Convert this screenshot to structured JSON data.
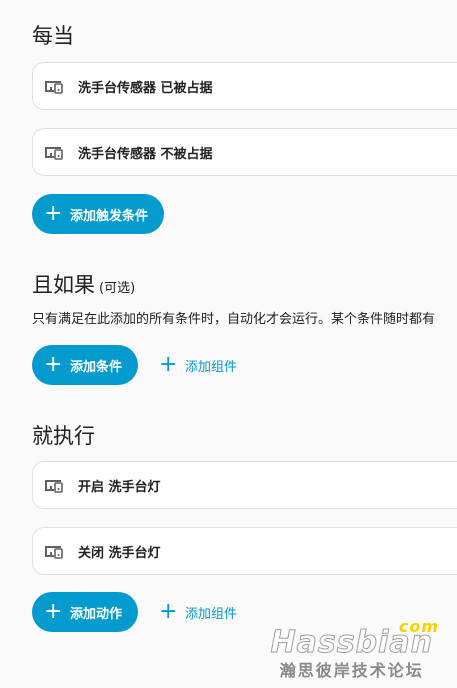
{
  "when": {
    "title": "每当",
    "triggers": [
      {
        "label": "洗手台传感器 已被占据",
        "icon": "device-icon"
      },
      {
        "label": "洗手台传感器 不被占据",
        "icon": "device-icon"
      }
    ],
    "add_trigger_label": "添加触发条件"
  },
  "and_if": {
    "title": "且如果",
    "optional": "(可选)",
    "description": "只有满足在此添加的所有条件时，自动化才会运行。某个条件随时都有",
    "add_condition_label": "添加条件",
    "add_block_label": "添加组件"
  },
  "then_do": {
    "title": "就执行",
    "actions": [
      {
        "label": "开启 洗手台灯",
        "icon": "device-icon"
      },
      {
        "label": "关闭 洗手台灯",
        "icon": "device-icon"
      }
    ],
    "add_action_label": "添加动作",
    "add_block_label": "添加组件"
  },
  "watermark": {
    "brand": "Hassbian",
    "com": "com",
    "sub": "瀚思彼岸技术论坛"
  },
  "colors": {
    "accent": "#039bcd",
    "background": "#fafafa",
    "card": "#ffffff"
  }
}
